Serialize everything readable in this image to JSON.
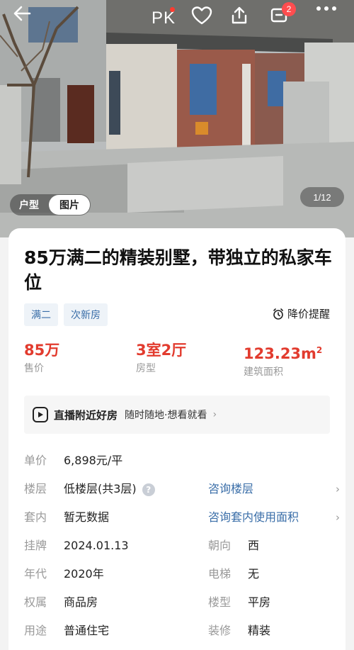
{
  "topbar": {
    "pk_label": "PK",
    "message_count": "2"
  },
  "gallery": {
    "tabs": [
      "户型",
      "图片"
    ],
    "active_tab": "图片",
    "counter": "1/12"
  },
  "listing": {
    "title": "85万满二的精装别墅，带独立的私家车位",
    "tags": [
      "满二",
      "次新房"
    ],
    "price_alert": "降价提醒",
    "stats": [
      {
        "value": "85万",
        "label": "售价"
      },
      {
        "value": "3室2厅",
        "label": "房型"
      },
      {
        "value": "123.23m",
        "sup": "2",
        "label": "建筑面积"
      }
    ],
    "live": {
      "title": "直播附近好房",
      "subtitle": "随时随地·想看就看",
      "arrow": "›"
    }
  },
  "details": {
    "unit_price": {
      "label": "单价",
      "value": "6,898元/平"
    },
    "floor": {
      "label": "楼层",
      "value": "低楼层(共3层)",
      "link": "咨询楼层"
    },
    "inner": {
      "label": "套内",
      "value": "暂无数据",
      "link": "咨询套内使用面积"
    },
    "listed": {
      "label": "挂牌",
      "value": "2024.01.13",
      "label2": "朝向",
      "value2": "西"
    },
    "year": {
      "label": "年代",
      "value": "2020年",
      "label2": "电梯",
      "value2": "无"
    },
    "ownership": {
      "label": "权属",
      "value": "商品房",
      "label2": "楼型",
      "value2": "平房"
    },
    "usage": {
      "label": "用途",
      "value": "普通住宅",
      "label2": "装修",
      "value2": "精装"
    }
  },
  "colors": {
    "accent_red": "#e23b2e",
    "link_blue": "#3a6ea8",
    "tag_bg": "#eef3f8"
  }
}
